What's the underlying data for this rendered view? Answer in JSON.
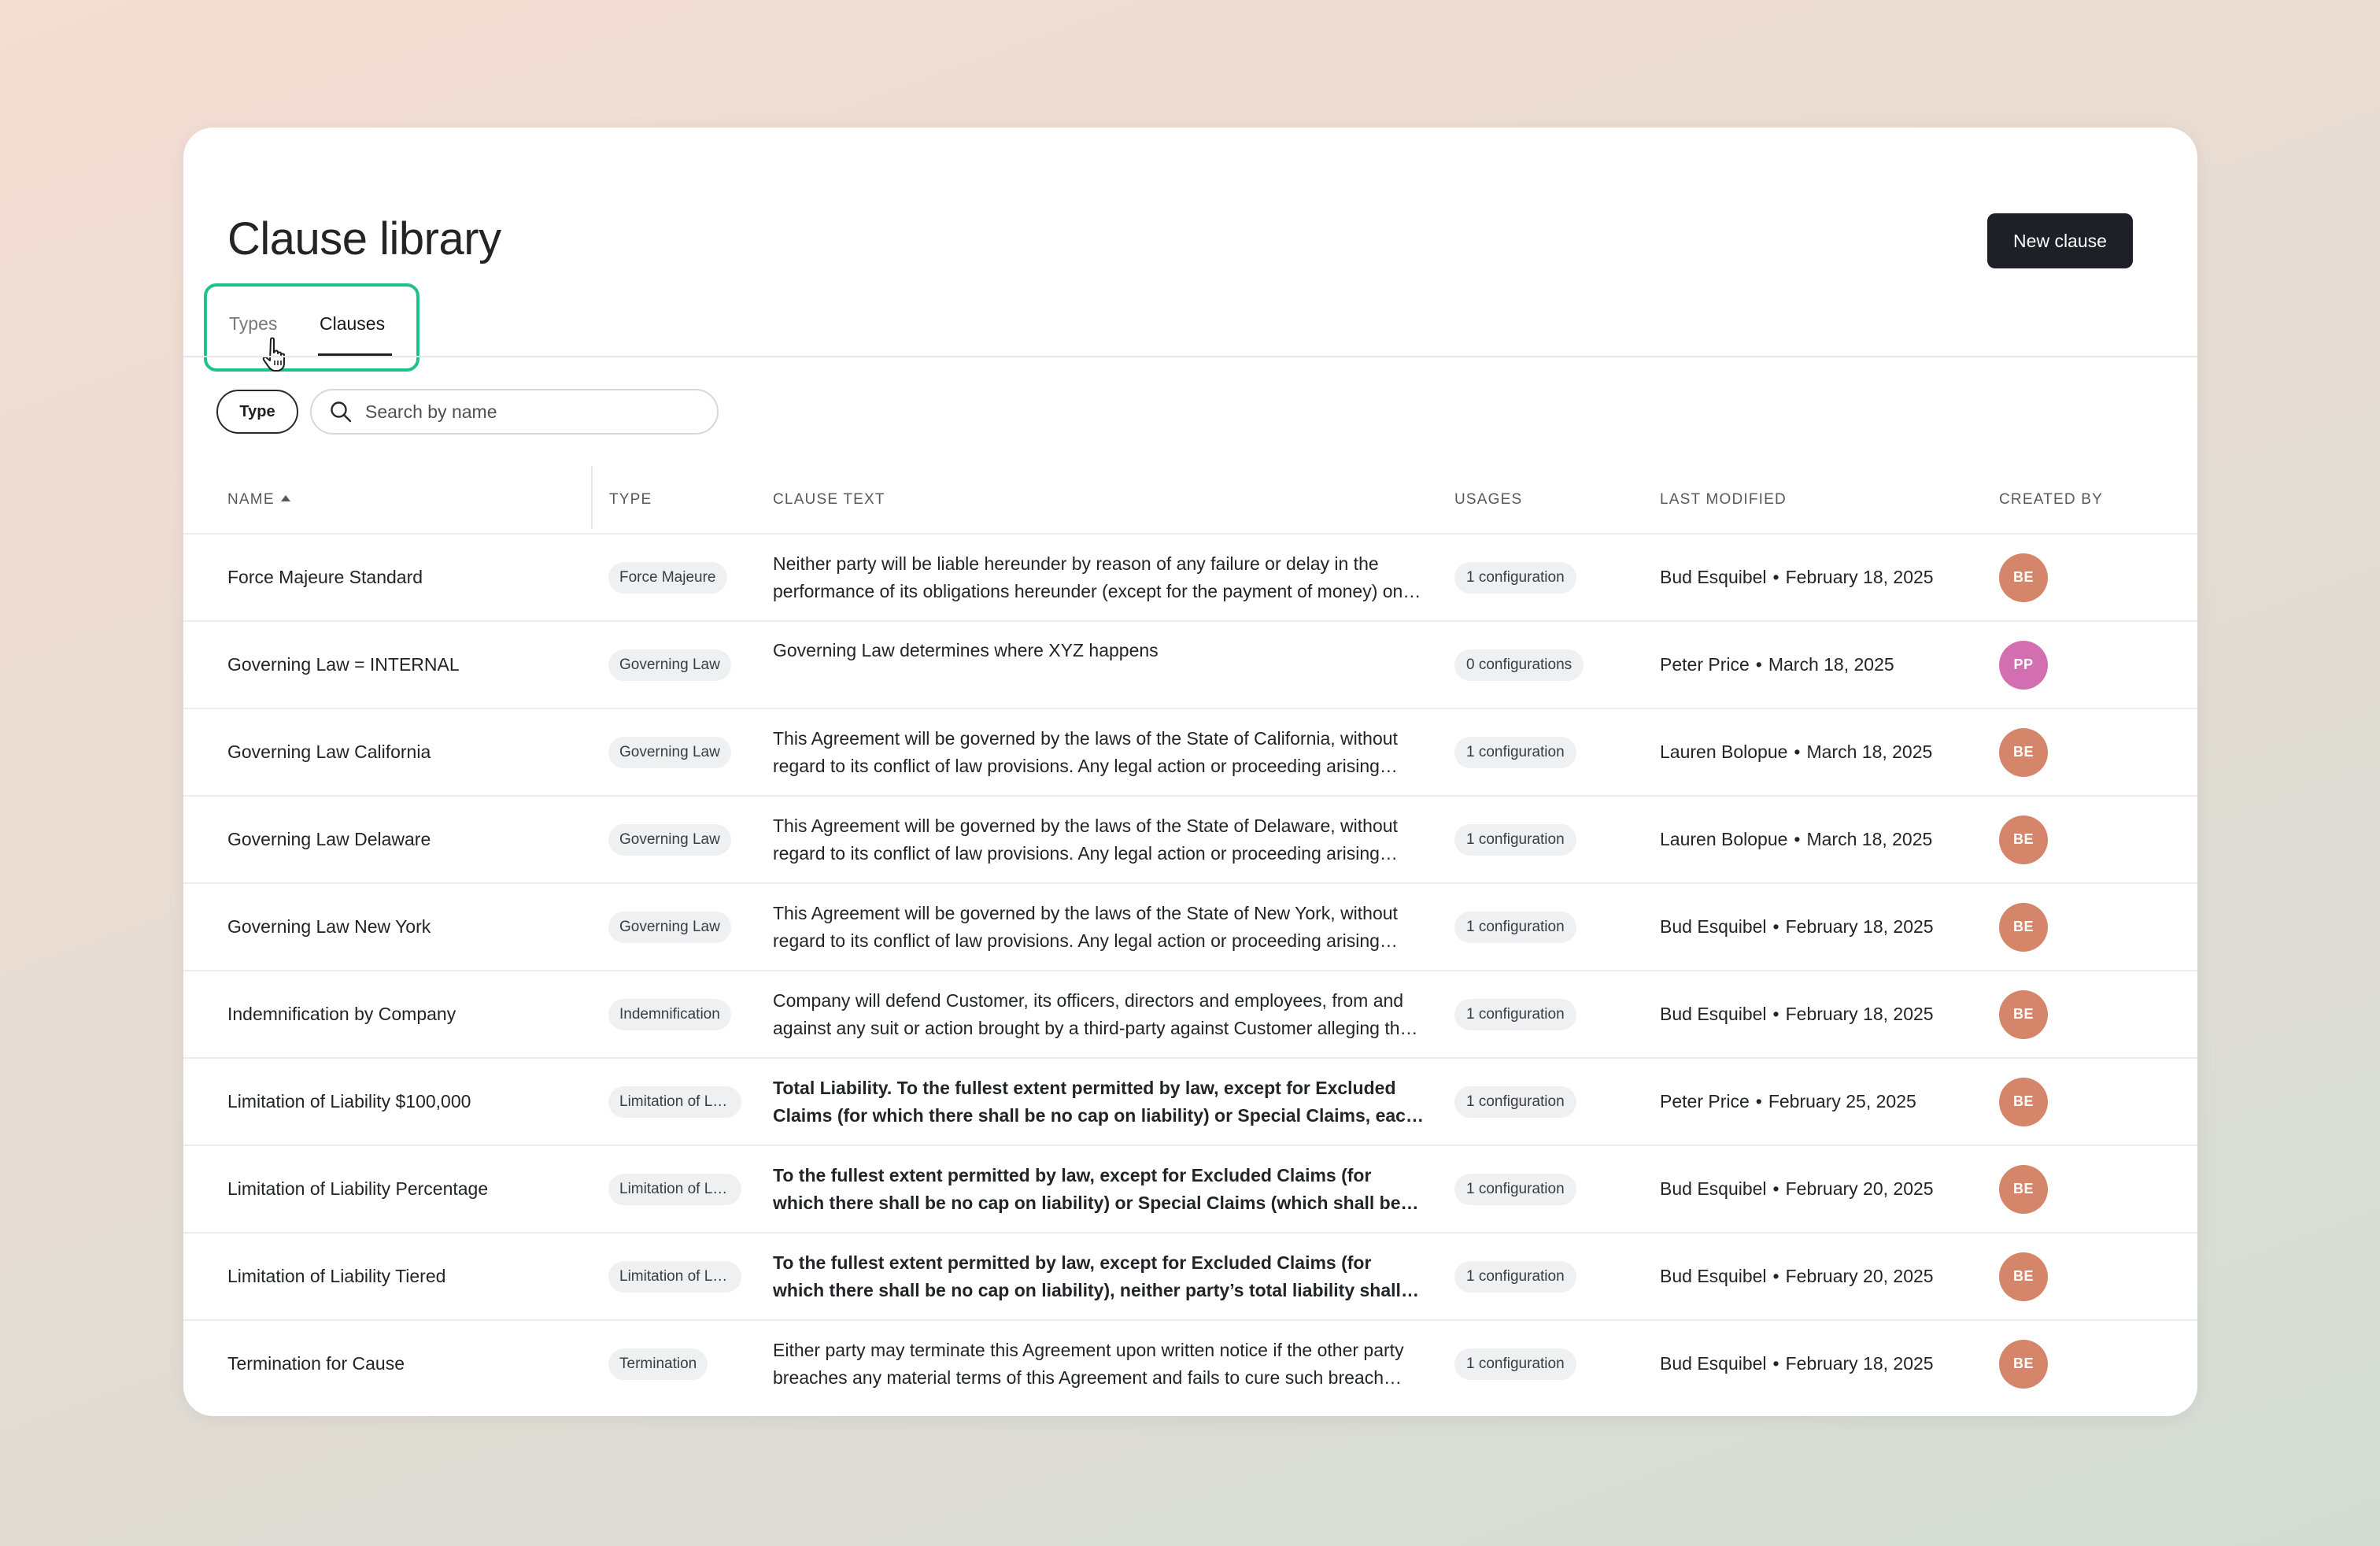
{
  "page": {
    "title": "Clause library",
    "new_clause_label": "New clause"
  },
  "tabs": [
    {
      "label": "Types",
      "active": false
    },
    {
      "label": "Clauses",
      "active": true
    }
  ],
  "filters": {
    "type_label": "Type",
    "search_placeholder": "Search by name"
  },
  "columns": {
    "name": "NAME",
    "type": "TYPE",
    "clause_text": "CLAUSE TEXT",
    "usages": "USAGES",
    "last_modified": "LAST MODIFIED",
    "created_by": "CREATED BY"
  },
  "colors": {
    "highlight": "#1ec28a",
    "avatar_be": "#d4856a",
    "avatar_pp": "#d36fb1",
    "primary_button": "#1d2027"
  },
  "rows": [
    {
      "name": "Force Majeure Standard",
      "type": "Force Majeure",
      "text": "Neither party will be liable hereunder by reason of any failure or delay in the performance of its obligations hereunder (except for the payment of money) on account of strikes, shortages, riots, insurrection, fires, flood, storm, explosions, acts of God, war, governmental action.",
      "bold": false,
      "usage": "1 configuration",
      "author": "Bud Esquibel",
      "date": "February 18, 2025",
      "initials": "BE"
    },
    {
      "name": "Governing Law = INTERNAL",
      "type": "Governing Law",
      "text": "Governing Law determines where XYZ happens",
      "bold": false,
      "usage": "0 configurations",
      "author": "Peter Price",
      "date": "March 18, 2025",
      "initials": "PP"
    },
    {
      "name": "Governing Law California",
      "type": "Governing Law",
      "text": "This Agreement will be governed by the laws of the State of California, without regard to its conflict of law provisions.  Any legal action or proceeding arising under this Agreement will be brought exclusively in the courts located in California.",
      "bold": false,
      "usage": "1 configuration",
      "author": "Lauren Bolopue",
      "date": "March 18, 2025",
      "initials": "BE"
    },
    {
      "name": "Governing Law Delaware",
      "type": "Governing Law",
      "text": "This Agreement will be governed by the laws of the State of Delaware, without regard to its conflict of law provisions.  Any legal action or proceeding arising under this Agreement will be brought exclusively in the courts located in Delaware.",
      "bold": false,
      "usage": "1 configuration",
      "author": "Lauren Bolopue",
      "date": "March 18, 2025",
      "initials": "BE"
    },
    {
      "name": "Governing Law New York",
      "type": "Governing Law",
      "text": "This Agreement will be governed by the laws of the State of New York, without regard to its conflict of law provisions.  Any legal action or proceeding arising under this Agreement will be brought exclusively in the courts located in New York.",
      "bold": false,
      "usage": "1 configuration",
      "author": "Bud Esquibel",
      "date": "February 18, 2025",
      "initials": "BE"
    },
    {
      "name": "Indemnification by Company",
      "type": "Indemnification",
      "text": "Company will defend Customer, its officers, directors and employees, from and against any suit or action brought by a third-party against Customer alleging that the services infringe any intellectual property right.",
      "bold": false,
      "usage": "1 configuration",
      "author": "Bud Esquibel",
      "date": "February 18, 2025",
      "initials": "BE"
    },
    {
      "name": "Limitation of Liability $100,000",
      "type": "Limitation of Liability",
      "text": "Total Liability.  To the fullest extent permitted by law, except for Excluded Claims (for which there shall be no cap on liability) or Special Claims, each party's total liability shall not exceed $100,000.",
      "bold": true,
      "usage": "1 configuration",
      "author": "Peter Price",
      "date": "February 25, 2025",
      "initials": "BE"
    },
    {
      "name": "Limitation of Liability Percentage",
      "type": "Limitation of Liability",
      "text": "To the fullest extent permitted by law, except for Excluded Claims (for which there shall be no cap on liability) or Special Claims (which shall be subject to the Special Cap), each party's total liability shall not exceed a percentage of fees paid.",
      "bold": true,
      "usage": "1 configuration",
      "author": "Bud Esquibel",
      "date": "February 20, 2025",
      "initials": "BE"
    },
    {
      "name": "Limitation of Liability Tiered",
      "type": "Limitation of Liability",
      "text": "To the fullest extent permitted by law, except for Excluded Claims (for which there shall be no cap on liability), neither party’s total liability shall exceed the applicable tiered amount.",
      "bold": true,
      "usage": "1 configuration",
      "author": "Bud Esquibel",
      "date": "February 20, 2025",
      "initials": "BE"
    },
    {
      "name": "Termination for Cause",
      "type": "Termination",
      "text": "Either party may terminate this Agreement upon written notice if the other party breaches any material terms of this Agreement and fails to cure such breach within thirty (30) days after receiving notice.",
      "bold": false,
      "usage": "1 configuration",
      "author": "Bud Esquibel",
      "date": "February 18, 2025",
      "initials": "BE"
    }
  ]
}
